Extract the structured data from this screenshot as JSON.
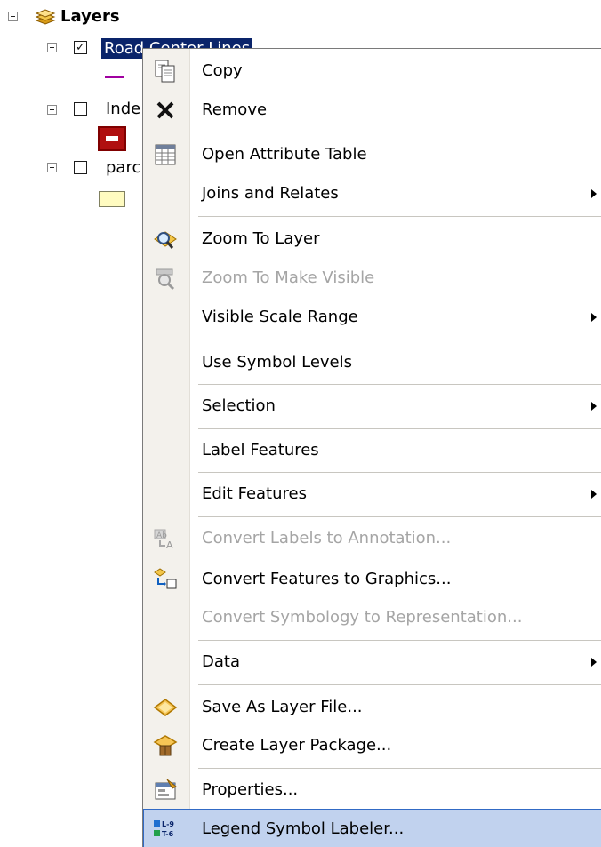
{
  "toc": {
    "root_label": "Layers",
    "layers": [
      {
        "label": "Road Center Lines",
        "checked": true
      },
      {
        "label": "Inde",
        "checked": false
      },
      {
        "label": "parc",
        "checked": false
      }
    ]
  },
  "menu": {
    "items": [
      {
        "label": "Copy",
        "icon": "copy-icon"
      },
      {
        "label": "Remove",
        "icon": "remove-icon"
      },
      {
        "label": "Open Attribute Table",
        "icon": "table-icon"
      },
      {
        "label": "Joins and Relates",
        "submenu": true
      },
      {
        "label": "Zoom To Layer",
        "icon": "zoom-to-layer-icon"
      },
      {
        "label": "Zoom To Make Visible",
        "icon": "zoom-visible-icon",
        "disabled": true
      },
      {
        "label": "Visible Scale Range",
        "submenu": true
      },
      {
        "label": "Use Symbol Levels"
      },
      {
        "label": "Selection",
        "submenu": true
      },
      {
        "label": "Label Features"
      },
      {
        "label": "Edit Features",
        "submenu": true
      },
      {
        "label": "Convert Labels to Annotation...",
        "icon": "convert-labels-icon",
        "disabled": true
      },
      {
        "label": "Convert Features to Graphics...",
        "icon": "convert-features-icon"
      },
      {
        "label": "Convert Symbology to Representation...",
        "disabled": true
      },
      {
        "label": "Data",
        "submenu": true
      },
      {
        "label": "Save As Layer File...",
        "icon": "layer-file-icon"
      },
      {
        "label": "Create Layer Package...",
        "icon": "layer-package-icon"
      },
      {
        "label": "Properties...",
        "icon": "properties-icon"
      },
      {
        "label": "Legend Symbol Labeler...",
        "icon": "legend-labeler-icon",
        "highlighted": true
      }
    ],
    "legend_icon_text": [
      "L-9",
      "T-6"
    ]
  },
  "colors": {
    "selection_bg": "#0a246a",
    "menu_highlight": "#c1d2ee",
    "disabled_text": "#a5a5a5",
    "road_line": "#a000a0",
    "index_symbol": "#b01010",
    "parcel_fill": "#fffbc0"
  }
}
